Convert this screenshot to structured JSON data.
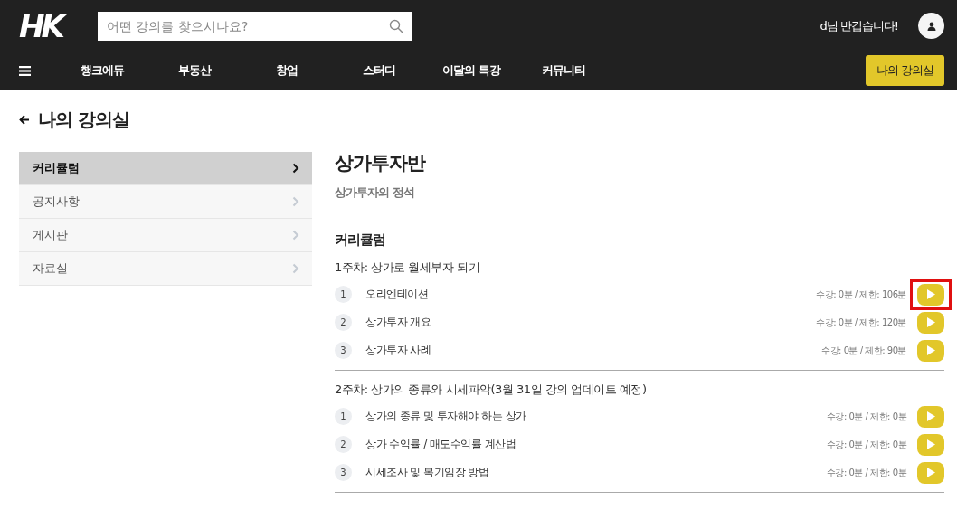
{
  "header": {
    "logo": "HK",
    "search": {
      "placeholder": "어떤 강의를 찾으시나요?"
    },
    "greeting": "d님 반갑습니다!"
  },
  "nav": {
    "items": [
      "행크에듀",
      "부동산",
      "창업",
      "스터디",
      "이달의 특강",
      "커뮤니티"
    ],
    "my_button": "나의 강의실"
  },
  "page_title": "나의 강의실",
  "sidebar": {
    "items": [
      {
        "label": "커리큘럼",
        "selected": true
      },
      {
        "label": "공지사항",
        "selected": false
      },
      {
        "label": "게시판",
        "selected": false
      },
      {
        "label": "자료실",
        "selected": false
      }
    ]
  },
  "course": {
    "title": "상가투자반",
    "subtitle": "상가투자의 정석",
    "section_title": "커리큘럼",
    "weeks": [
      {
        "title": "1주차: 상가로 월세부자 되기",
        "lessons": [
          {
            "number": "1",
            "title": "오리엔테이션",
            "time": "수강: 0분 / 제한: 106분",
            "highlighted": true
          },
          {
            "number": "2",
            "title": "상가투자 개요",
            "time": "수강: 0분 / 제한: 120분",
            "highlighted": false
          },
          {
            "number": "3",
            "title": "상가투자 사례",
            "time": "수강: 0분 / 제한: 90분",
            "highlighted": false
          }
        ]
      },
      {
        "title": "2주차: 상가의 종류와 시세파악(3월 31일 강의 업데이트 예정)",
        "lessons": [
          {
            "number": "1",
            "title": "상가의 종류 및 투자해야 하는 상가",
            "time": "수강: 0분 / 제한: 0분",
            "highlighted": false
          },
          {
            "number": "2",
            "title": "상가 수익률 / 매도수익률 계산법",
            "time": "수강: 0분 / 제한: 0분",
            "highlighted": false
          },
          {
            "number": "3",
            "title": "시세조사 및 복기임장 방법",
            "time": "수강: 0분 / 제한: 0분",
            "highlighted": false
          }
        ]
      }
    ]
  }
}
